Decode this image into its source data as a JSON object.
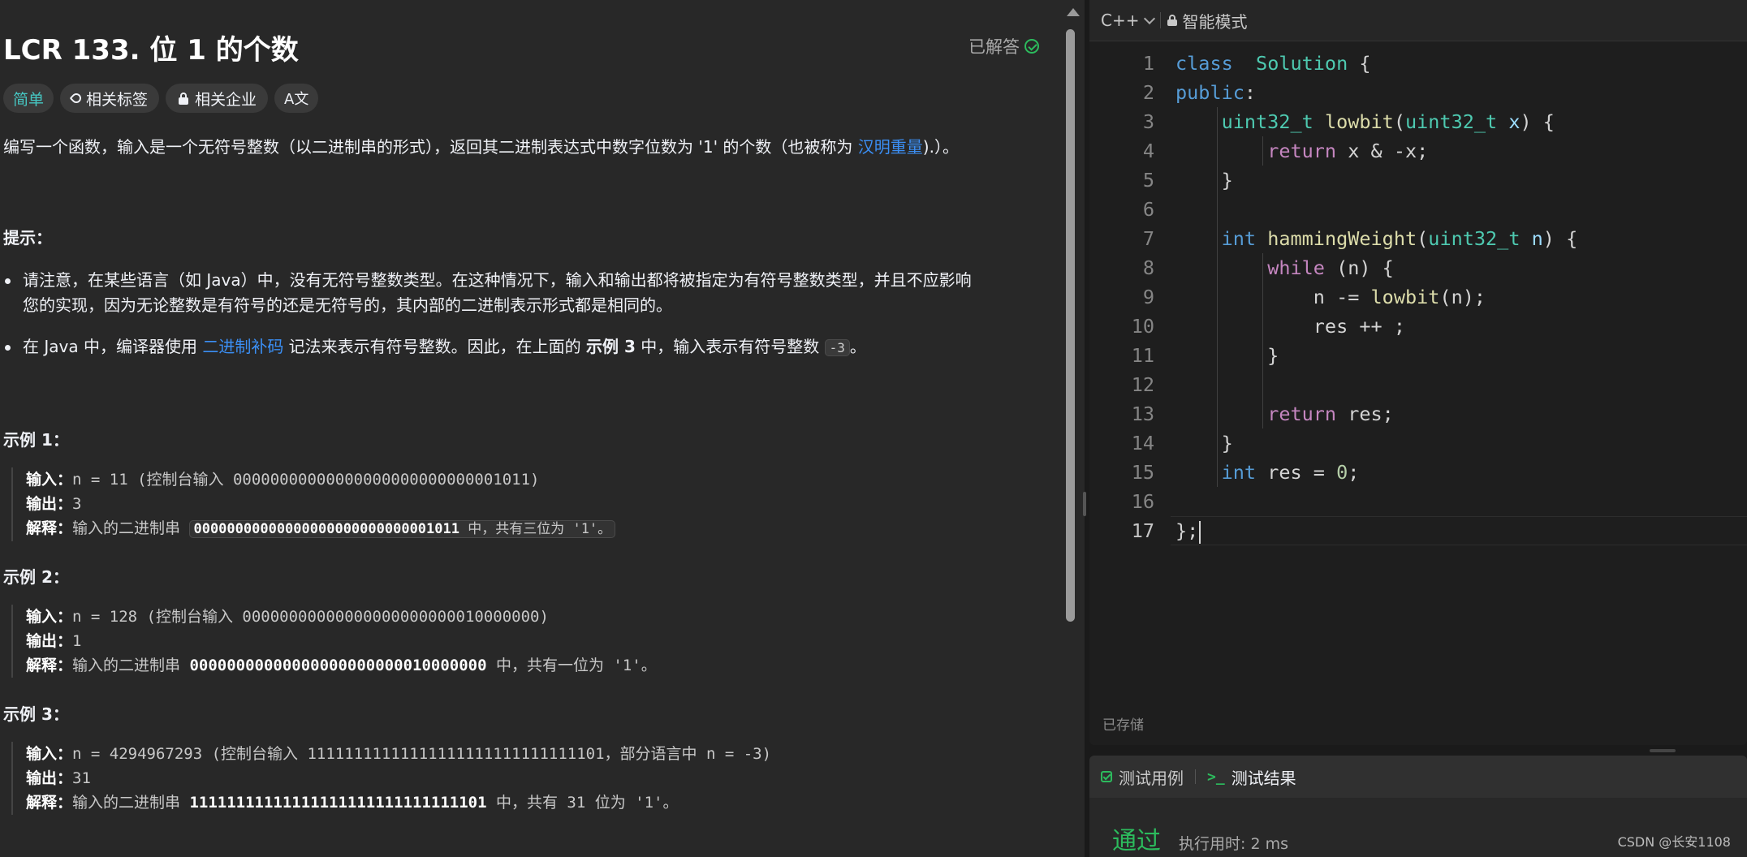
{
  "problem": {
    "title": "LCR 133. 位 1 的个数",
    "status": "已解答",
    "tags": {
      "difficulty": "简单",
      "related_tags": "相关标签",
      "related_companies": "相关企业",
      "translate": "A文"
    },
    "description": {
      "text_before": "编写一个函数，输入是一个无符号整数（以二进制串的形式），返回其二进制表达式中数字位数为 '1' 的个数（也被称为 ",
      "link": "汉明重量",
      "text_after": ").）。"
    },
    "hint": {
      "title": "提示：",
      "bullet1_line1": "请注意，在某些语言（如 Java）中，没有无符号整数类型。在这种情况下，输入和输出都将被指定为有符号整数类型，并且不应影响",
      "bullet1_line2": "您的实现，因为无论整数是有符号的还是无符号的，其内部的二进制表示形式都是相同的。",
      "bullet2_before": "在 Java 中，编译器使用 ",
      "bullet2_link": "二进制补码",
      "bullet2_mid": " 记法来表示有符号整数。因此，在上面的 ",
      "bullet2_bold": "示例 3",
      "bullet2_after": " 中，输入表示有符号整数 ",
      "bullet2_code": "-3",
      "bullet2_end": "。"
    },
    "labels": {
      "input": "输入：",
      "output": "输出：",
      "explanation": "解释："
    },
    "examples": [
      {
        "title": "示例 1：",
        "input": "n = 11 (控制台输入 00000000000000000000000000001011)",
        "output": "3",
        "expl_before": "输入的二进制串 ",
        "expl_bold": "00000000000000000000000000001011",
        "expl_after": " 中，共有三位为 '1'。"
      },
      {
        "title": "示例 2：",
        "input": "n = 128 (控制台输入 00000000000000000000000010000000)",
        "output": "1",
        "expl_before": "输入的二进制串 ",
        "expl_bold": "00000000000000000000000010000000",
        "expl_after": " 中，共有一位为 '1'。"
      },
      {
        "title": "示例 3：",
        "input": "n = 4294967293 (控制台输入 11111111111111111111111111111101，部分语言中 n = -3)",
        "output": "31",
        "expl_before": "输入的二进制串 ",
        "expl_bold": "11111111111111111111111111111101",
        "expl_after": " 中，共有 31 位为 '1'。"
      }
    ]
  },
  "editor": {
    "language": "C++",
    "mode": "智能模式",
    "saved": "已存储",
    "lines": [
      {
        "n": "1",
        "tokens": [
          [
            "kw",
            "class"
          ],
          [
            "",
            "  "
          ],
          [
            "ty",
            "Solution"
          ],
          [
            "",
            " {"
          ]
        ]
      },
      {
        "n": "2",
        "tokens": [
          [
            "kw",
            "public"
          ],
          [
            "",
            ":"
          ]
        ]
      },
      {
        "n": "3",
        "tokens": [
          [
            "",
            "    "
          ],
          [
            "ty",
            "uint32_t"
          ],
          [
            "",
            ""
          ],
          [
            "",
            " "
          ],
          [
            "fn",
            "lowbit"
          ],
          [
            "",
            "("
          ],
          [
            "ty",
            "uint32_t"
          ],
          [
            "",
            " "
          ],
          [
            "prm",
            "x"
          ],
          [
            "",
            ") {"
          ]
        ]
      },
      {
        "n": "4",
        "tokens": [
          [
            "",
            "        "
          ],
          [
            "ctl",
            "return"
          ],
          [
            "",
            " x & -x;"
          ]
        ]
      },
      {
        "n": "5",
        "tokens": [
          [
            "",
            "    }"
          ]
        ]
      },
      {
        "n": "6",
        "tokens": []
      },
      {
        "n": "7",
        "tokens": [
          [
            "",
            "    "
          ],
          [
            "kw",
            "int"
          ],
          [
            "",
            " "
          ],
          [
            "fn",
            "hammingWeight"
          ],
          [
            "",
            "("
          ],
          [
            "ty",
            "uint32_t"
          ],
          [
            "",
            " "
          ],
          [
            "prm",
            "n"
          ],
          [
            "",
            ") {"
          ]
        ]
      },
      {
        "n": "8",
        "tokens": [
          [
            "",
            "        "
          ],
          [
            "ctl",
            "while"
          ],
          [
            "",
            " (n) {"
          ]
        ]
      },
      {
        "n": "9",
        "tokens": [
          [
            "",
            "            n -= "
          ],
          [
            "fn",
            "lowbit"
          ],
          [
            "",
            "(n);"
          ]
        ]
      },
      {
        "n": "10",
        "tokens": [
          [
            "",
            "            res ++ ;"
          ]
        ]
      },
      {
        "n": "11",
        "tokens": [
          [
            "",
            "        }"
          ]
        ]
      },
      {
        "n": "12",
        "tokens": []
      },
      {
        "n": "13",
        "tokens": [
          [
            "",
            "        "
          ],
          [
            "ctl",
            "return"
          ],
          [
            "",
            " res;"
          ]
        ]
      },
      {
        "n": "14",
        "tokens": [
          [
            "",
            "    }"
          ]
        ]
      },
      {
        "n": "15",
        "tokens": [
          [
            "",
            "    "
          ],
          [
            "kw",
            "int"
          ],
          [
            "",
            " res = "
          ],
          [
            "num",
            "0"
          ],
          [
            "",
            ";"
          ]
        ]
      },
      {
        "n": "16",
        "tokens": []
      },
      {
        "n": "17",
        "tokens": [
          [
            "",
            "};"
          ]
        ]
      }
    ]
  },
  "bottom": {
    "tab_testcases": "测试用例",
    "tab_results": "测试结果",
    "result": "通过",
    "runtime": "执行用时: 2 ms"
  },
  "watermark": "CSDN @长安1108",
  "colors": {
    "accent_green": "#2cbb5d",
    "easy_teal": "#46c6c2",
    "link_blue": "#3b8ff5"
  }
}
